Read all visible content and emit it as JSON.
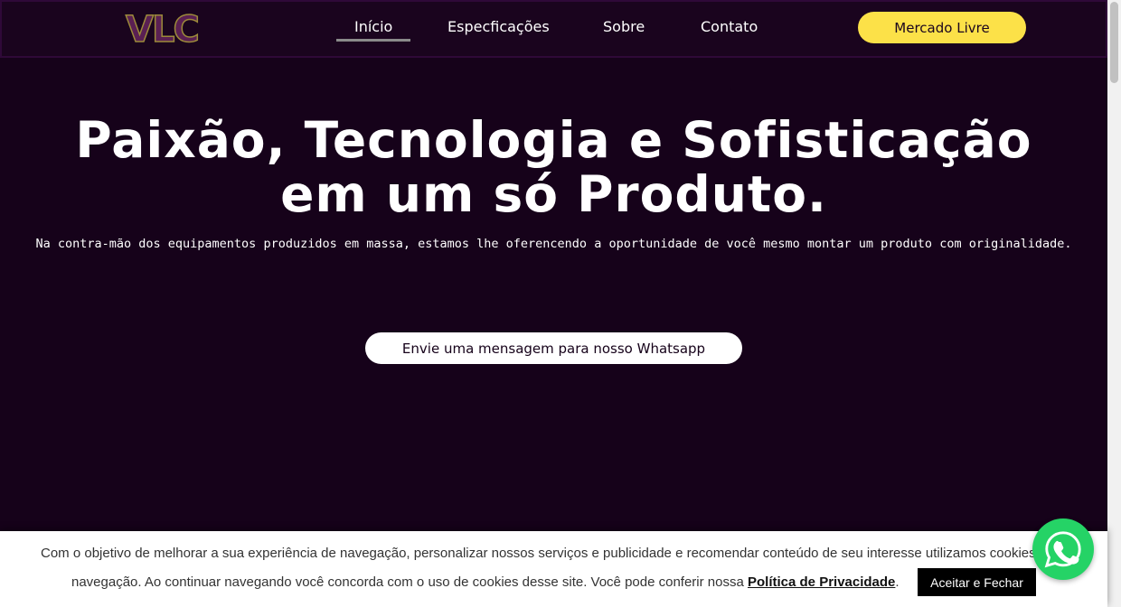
{
  "header": {
    "logo_text": "VLC",
    "nav": [
      {
        "label": "Início",
        "active": true
      },
      {
        "label": "Especficações"
      },
      {
        "label": "Sobre"
      },
      {
        "label": "Contato"
      }
    ],
    "cta_label": "Mercado Livre"
  },
  "hero": {
    "title": "Paixão, Tecnologia e Sofisticação em um só Produto.",
    "subtitle": "Na contra-mão dos equipamentos produzidos em massa, estamos lhe oferencendo a oportunidade de você mesmo montar um produto com originalidade.",
    "cta_label": "Envie uma mensagem para nosso Whatsapp"
  },
  "cookie": {
    "line1": "Com o objetivo de melhorar a sua experiência de navegação, personalizar nossos serviços e publicidade e recomendar conteúdo de seu interesse utilizamos cookies em sua",
    "line2_prefix": "navegação. Ao continuar navegando você concorda com o uso de cookies desse site. Você pode conferir nossa ",
    "policy_link": "Política de Privacidade",
    "line2_suffix": ".",
    "accept_label": "Aceitar e Fechar"
  },
  "icons": {
    "whatsapp": "whatsapp-icon"
  },
  "colors": {
    "background": "#16021a",
    "accent": "#fce148",
    "whatsapp": "#25d366"
  }
}
